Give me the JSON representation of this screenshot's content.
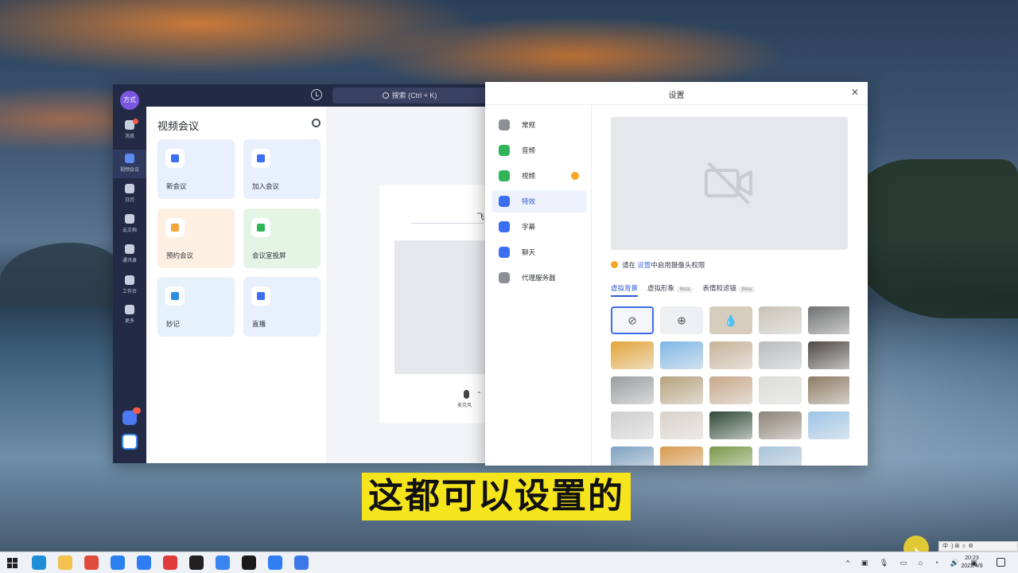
{
  "app": {
    "avatar_text": "方式",
    "search_placeholder": "搜索 (Ctrl + K)",
    "rail": [
      {
        "label": "消息",
        "icon": "chat-icon"
      },
      {
        "label": "视频会议",
        "icon": "video-meeting-icon",
        "active": true
      },
      {
        "label": "日历",
        "icon": "calendar-icon"
      },
      {
        "label": "云文档",
        "icon": "cloud-doc-icon"
      },
      {
        "label": "通讯录",
        "icon": "contacts-icon"
      },
      {
        "label": "工作台",
        "icon": "workbench-icon"
      },
      {
        "label": "更多",
        "icon": "more-icon"
      }
    ],
    "panel_title": "视频会议",
    "tiles": [
      {
        "label": "新会议",
        "icon": "camera-icon",
        "bg": "#e9f0fd",
        "accent": "#3b6ef0"
      },
      {
        "label": "加入会议",
        "icon": "join-icon",
        "bg": "#e9f0fd",
        "accent": "#3b6ef0"
      },
      {
        "label": "预约会议",
        "icon": "schedule-icon",
        "bg": "#fdf0e2",
        "accent": "#f2a63b"
      },
      {
        "label": "会议室投屏",
        "icon": "cast-icon",
        "bg": "#e4f5e6",
        "accent": "#2fb45a"
      },
      {
        "label": "妙记",
        "icon": "minutes-icon",
        "bg": "#e6f2fb",
        "accent": "#2a8fe0"
      },
      {
        "label": "直播",
        "icon": "live-icon",
        "bg": "#e9f0fd",
        "accent": "#3b6ef0"
      }
    ],
    "right_partial_text": "飞",
    "mic_label": "麦克风"
  },
  "settings": {
    "title": "设置",
    "nav": [
      {
        "label": "常规",
        "color": "#8c8f96"
      },
      {
        "label": "音频",
        "color": "#2fb45a"
      },
      {
        "label": "视频",
        "color": "#2fb45a",
        "warning": true
      },
      {
        "label": "特效",
        "color": "#3b6ef0",
        "active": true
      },
      {
        "label": "字幕",
        "color": "#3b6ef0"
      },
      {
        "label": "聊天",
        "color": "#3b6ef0"
      },
      {
        "label": "代理服务器",
        "color": "#8c8f96"
      }
    ],
    "notice_prefix": "请在",
    "notice_link": "设置",
    "notice_suffix": "中启用摄像头权限",
    "tabs": [
      {
        "label": "虚拟背景",
        "active": true,
        "beta": ""
      },
      {
        "label": "虚拟形象",
        "beta": "Beta"
      },
      {
        "label": "表情和滤镜",
        "beta": "Beta"
      }
    ],
    "backgrounds": [
      {
        "kind": "none",
        "glyph": "⊘",
        "color": "#f4f6fb"
      },
      {
        "kind": "add",
        "glyph": "⊕",
        "color": "#eeeff2"
      },
      {
        "kind": "blur",
        "glyph": "💧",
        "color": "#d6cdbd"
      },
      {
        "kind": "image",
        "color": "#c9c2b8"
      },
      {
        "kind": "image",
        "color": "#6f7070"
      },
      {
        "kind": "image",
        "color": "#e3a53a"
      },
      {
        "kind": "image",
        "color": "#7fb7e6"
      },
      {
        "kind": "image",
        "color": "#c8b39a"
      },
      {
        "kind": "image",
        "color": "#b9bbbd"
      },
      {
        "kind": "image",
        "color": "#4e4a45"
      },
      {
        "kind": "image",
        "color": "#9a9d9f"
      },
      {
        "kind": "image",
        "color": "#b7a27e"
      },
      {
        "kind": "image",
        "color": "#c7a88a"
      },
      {
        "kind": "image",
        "color": "#dcdcd8"
      },
      {
        "kind": "image",
        "color": "#8e7b64"
      },
      {
        "kind": "image",
        "color": "#cfcfcf"
      },
      {
        "kind": "image",
        "color": "#d9d2ca"
      },
      {
        "kind": "image",
        "color": "#2f4a36"
      },
      {
        "kind": "image",
        "color": "#8d8276"
      },
      {
        "kind": "image",
        "color": "#9cc4e6"
      },
      {
        "kind": "image",
        "color": "#7fa2c2"
      },
      {
        "kind": "image",
        "color": "#d89a4e"
      },
      {
        "kind": "image",
        "color": "#7a9a4c"
      },
      {
        "kind": "image",
        "color": "#a9c3da"
      }
    ]
  },
  "subtitle": "这都可以设置的",
  "ime_bar": "中 ·) ⊞ ☺ ⚙",
  "taskbar": {
    "apps": [
      {
        "icon": "edge-icon",
        "color": "#1f8ed8"
      },
      {
        "icon": "file-explorer-icon",
        "color": "#f2c14e"
      },
      {
        "icon": "chrome-icon",
        "color": "#e14b3b"
      },
      {
        "icon": "feishu-icon",
        "color": "#2a7ff0"
      },
      {
        "icon": "tencent-meeting-icon",
        "color": "#2f7df2"
      },
      {
        "icon": "wps-icon",
        "color": "#e03b3b"
      },
      {
        "icon": "video-editor-icon",
        "color": "#202020"
      },
      {
        "icon": "lark-icon",
        "color": "#3a84f2"
      },
      {
        "icon": "capcut-icon",
        "color": "#1b1b1b"
      },
      {
        "icon": "dingtalk-icon",
        "color": "#2f7ef2"
      },
      {
        "icon": "app-icon",
        "color": "#3b78e7"
      }
    ],
    "tray_text": "^ ▣ 🎙 ▭ ⌂ ◔ 🔊 ▣",
    "time": "20:23",
    "date": "2022/4/9"
  }
}
